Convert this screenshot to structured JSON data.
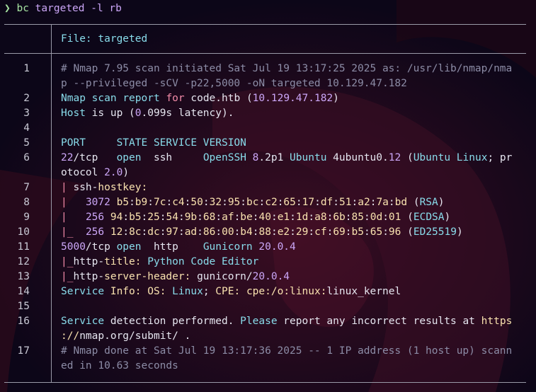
{
  "prompt": {
    "symbol": "❯",
    "command": "bc",
    "args": "targeted -l rb"
  },
  "file": {
    "label": "File:",
    "name": "targeted"
  },
  "lines": [
    {
      "n": "1",
      "rows": [
        [
          [
            "c-gray",
            "# Nmap 7.95 scan initiated Sat Jul 19 13:17:25 2025 as: /usr/lib/nmap/nma"
          ]
        ],
        [
          [
            "c-gray",
            "p --privileged -sCV -p22,5000 -oN targeted 10.129.47.182"
          ]
        ]
      ]
    },
    {
      "n": "2",
      "rows": [
        [
          [
            "c-cyan",
            "Nmap scan"
          ],
          [
            "c-white",
            " "
          ],
          [
            "c-cyan",
            "report"
          ],
          [
            "c-white",
            " "
          ],
          [
            "c-red",
            "for"
          ],
          [
            "c-white",
            " code.htb ("
          ],
          [
            "c-num",
            "10.129.47.182"
          ],
          [
            "c-white",
            ")"
          ]
        ]
      ]
    },
    {
      "n": "3",
      "rows": [
        [
          [
            "c-cyan",
            "Host"
          ],
          [
            "c-white",
            " is up ("
          ],
          [
            "c-num",
            "0"
          ],
          [
            "c-white",
            ".099s latency)."
          ]
        ]
      ]
    },
    {
      "n": "4",
      "rows": [
        []
      ]
    },
    {
      "n": "5",
      "rows": [
        [
          [
            "c-cyan",
            "PORT     STATE SERVICE VERSION"
          ]
        ]
      ]
    },
    {
      "n": "6",
      "rows": [
        [
          [
            "c-num",
            "22"
          ],
          [
            "c-white",
            "/tcp   "
          ],
          [
            "c-cyan",
            "open"
          ],
          [
            "c-white",
            "  ssh     "
          ],
          [
            "c-cyan",
            "OpenSSH"
          ],
          [
            "c-white",
            " "
          ],
          [
            "c-num",
            "8"
          ],
          [
            "c-white",
            ".2p1 "
          ],
          [
            "c-cyan",
            "Ubuntu"
          ],
          [
            "c-white",
            " 4ubuntu0."
          ],
          [
            "c-num",
            "12"
          ],
          [
            "c-white",
            " ("
          ],
          [
            "c-cyan",
            "Ubuntu Linux"
          ],
          [
            "c-white",
            "; pr"
          ]
        ],
        [
          [
            "c-white",
            "otocol "
          ],
          [
            "c-num",
            "2.0"
          ],
          [
            "c-white",
            ")"
          ]
        ]
      ]
    },
    {
      "n": "7",
      "rows": [
        [
          [
            "c-red",
            "| "
          ],
          [
            "c-white",
            "ssh-"
          ],
          [
            "c-yellow",
            "hostkey:"
          ]
        ]
      ]
    },
    {
      "n": "8",
      "rows": [
        [
          [
            "c-red",
            "|"
          ],
          [
            "c-white",
            "   "
          ],
          [
            "c-num",
            "3072"
          ],
          [
            "c-white",
            " "
          ],
          [
            "c-yellow",
            "b5"
          ],
          [
            "c-white",
            ":"
          ],
          [
            "c-yellow",
            "b9"
          ],
          [
            "c-white",
            ":"
          ],
          [
            "c-yellow",
            "7c"
          ],
          [
            "c-white",
            ":"
          ],
          [
            "c-yellow",
            "c4"
          ],
          [
            "c-white",
            ":"
          ],
          [
            "c-yellow",
            "50"
          ],
          [
            "c-white",
            ":"
          ],
          [
            "c-yellow",
            "32"
          ],
          [
            "c-white",
            ":"
          ],
          [
            "c-yellow",
            "95"
          ],
          [
            "c-white",
            ":"
          ],
          [
            "c-yellow",
            "bc"
          ],
          [
            "c-white",
            ":"
          ],
          [
            "c-yellow",
            "c2"
          ],
          [
            "c-white",
            ":"
          ],
          [
            "c-yellow",
            "65"
          ],
          [
            "c-white",
            ":"
          ],
          [
            "c-yellow",
            "17"
          ],
          [
            "c-white",
            ":"
          ],
          [
            "c-yellow",
            "df"
          ],
          [
            "c-white",
            ":"
          ],
          [
            "c-yellow",
            "51"
          ],
          [
            "c-white",
            ":"
          ],
          [
            "c-yellow",
            "a2"
          ],
          [
            "c-white",
            ":"
          ],
          [
            "c-yellow",
            "7a"
          ],
          [
            "c-white",
            ":"
          ],
          [
            "c-yellow",
            "bd"
          ],
          [
            "c-white",
            " ("
          ],
          [
            "c-cyan",
            "RSA"
          ],
          [
            "c-white",
            ")"
          ]
        ]
      ]
    },
    {
      "n": "9",
      "rows": [
        [
          [
            "c-red",
            "|"
          ],
          [
            "c-white",
            "   "
          ],
          [
            "c-num",
            "256"
          ],
          [
            "c-white",
            " "
          ],
          [
            "c-yellow",
            "94"
          ],
          [
            "c-white",
            ":"
          ],
          [
            "c-yellow",
            "b5"
          ],
          [
            "c-white",
            ":"
          ],
          [
            "c-yellow",
            "25"
          ],
          [
            "c-white",
            ":"
          ],
          [
            "c-yellow",
            "54"
          ],
          [
            "c-white",
            ":"
          ],
          [
            "c-yellow",
            "9b"
          ],
          [
            "c-white",
            ":"
          ],
          [
            "c-yellow",
            "68"
          ],
          [
            "c-white",
            ":"
          ],
          [
            "c-yellow",
            "af"
          ],
          [
            "c-white",
            ":"
          ],
          [
            "c-yellow",
            "be"
          ],
          [
            "c-white",
            ":"
          ],
          [
            "c-yellow",
            "40"
          ],
          [
            "c-white",
            ":"
          ],
          [
            "c-yellow",
            "e1"
          ],
          [
            "c-white",
            ":"
          ],
          [
            "c-yellow",
            "1d"
          ],
          [
            "c-white",
            ":"
          ],
          [
            "c-yellow",
            "a8"
          ],
          [
            "c-white",
            ":"
          ],
          [
            "c-yellow",
            "6b"
          ],
          [
            "c-white",
            ":"
          ],
          [
            "c-yellow",
            "85"
          ],
          [
            "c-white",
            ":"
          ],
          [
            "c-yellow",
            "0d"
          ],
          [
            "c-white",
            ":"
          ],
          [
            "c-yellow",
            "01"
          ],
          [
            "c-white",
            " ("
          ],
          [
            "c-cyan",
            "ECDSA"
          ],
          [
            "c-white",
            ")"
          ]
        ]
      ]
    },
    {
      "n": "10",
      "rows": [
        [
          [
            "c-red",
            "|_"
          ],
          [
            "c-white",
            "  "
          ],
          [
            "c-num",
            "256"
          ],
          [
            "c-white",
            " "
          ],
          [
            "c-yellow",
            "12"
          ],
          [
            "c-white",
            ":"
          ],
          [
            "c-yellow",
            "8c"
          ],
          [
            "c-white",
            ":"
          ],
          [
            "c-yellow",
            "dc"
          ],
          [
            "c-white",
            ":"
          ],
          [
            "c-yellow",
            "97"
          ],
          [
            "c-white",
            ":"
          ],
          [
            "c-yellow",
            "ad"
          ],
          [
            "c-white",
            ":"
          ],
          [
            "c-yellow",
            "86"
          ],
          [
            "c-white",
            ":"
          ],
          [
            "c-yellow",
            "00"
          ],
          [
            "c-white",
            ":"
          ],
          [
            "c-yellow",
            "b4"
          ],
          [
            "c-white",
            ":"
          ],
          [
            "c-yellow",
            "88"
          ],
          [
            "c-white",
            ":"
          ],
          [
            "c-yellow",
            "e2"
          ],
          [
            "c-white",
            ":"
          ],
          [
            "c-yellow",
            "29"
          ],
          [
            "c-white",
            ":"
          ],
          [
            "c-yellow",
            "cf"
          ],
          [
            "c-white",
            ":"
          ],
          [
            "c-yellow",
            "69"
          ],
          [
            "c-white",
            ":"
          ],
          [
            "c-yellow",
            "b5"
          ],
          [
            "c-white",
            ":"
          ],
          [
            "c-yellow",
            "65"
          ],
          [
            "c-white",
            ":"
          ],
          [
            "c-yellow",
            "96"
          ],
          [
            "c-white",
            " ("
          ],
          [
            "c-cyan",
            "ED25519"
          ],
          [
            "c-white",
            ")"
          ]
        ]
      ]
    },
    {
      "n": "11",
      "rows": [
        [
          [
            "c-num",
            "5000"
          ],
          [
            "c-white",
            "/tcp "
          ],
          [
            "c-cyan",
            "open"
          ],
          [
            "c-white",
            "  http    "
          ],
          [
            "c-cyan",
            "Gunicorn"
          ],
          [
            "c-white",
            " "
          ],
          [
            "c-num",
            "20.0.4"
          ]
        ]
      ]
    },
    {
      "n": "12",
      "rows": [
        [
          [
            "c-red",
            "|_"
          ],
          [
            "c-white",
            "http-"
          ],
          [
            "c-yellow",
            "title:"
          ],
          [
            "c-white",
            " "
          ],
          [
            "c-cyan",
            "Python Code Editor"
          ]
        ]
      ]
    },
    {
      "n": "13",
      "rows": [
        [
          [
            "c-red",
            "|_"
          ],
          [
            "c-white",
            "http-"
          ],
          [
            "c-yellow",
            "server-header:"
          ],
          [
            "c-white",
            " gunicorn/"
          ],
          [
            "c-num",
            "20.0.4"
          ]
        ]
      ]
    },
    {
      "n": "14",
      "rows": [
        [
          [
            "c-cyan",
            "Service"
          ],
          [
            "c-white",
            " "
          ],
          [
            "c-yellow",
            "Info:"
          ],
          [
            "c-white",
            " "
          ],
          [
            "c-yellow",
            "OS:"
          ],
          [
            "c-white",
            " "
          ],
          [
            "c-cyan",
            "Linux"
          ],
          [
            "c-white",
            "; "
          ],
          [
            "c-yellow",
            "CPE:"
          ],
          [
            "c-white",
            " "
          ],
          [
            "c-yellow",
            "cpe:/o:linux:"
          ],
          [
            "c-white",
            "linux_kernel"
          ]
        ]
      ]
    },
    {
      "n": "15",
      "rows": [
        []
      ]
    },
    {
      "n": "16",
      "rows": [
        [
          [
            "c-cyan",
            "Service"
          ],
          [
            "c-white",
            " detection performed. "
          ],
          [
            "c-cyan",
            "Please"
          ],
          [
            "c-white",
            " report any incorrect results at "
          ],
          [
            "c-yellow",
            "https"
          ]
        ],
        [
          [
            "c-yellow",
            "://"
          ],
          [
            "c-white",
            "nmap.org/submit/ ."
          ]
        ]
      ]
    },
    {
      "n": "17",
      "rows": [
        [
          [
            "c-gray",
            "# Nmap done at Sat Jul 19 13:17:36 2025 -- 1 IP address (1 host up) scann"
          ]
        ],
        [
          [
            "c-gray",
            "ed in 10.63 seconds"
          ]
        ]
      ]
    }
  ]
}
